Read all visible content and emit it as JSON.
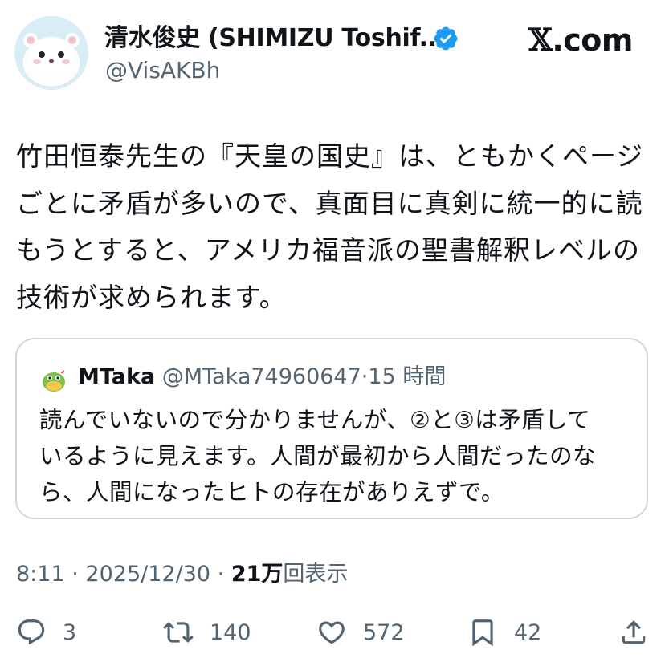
{
  "author": {
    "display_name": "清水俊史 (SHIMIZU Toshif...",
    "handle": "@VisAKBh",
    "verified": true
  },
  "site": {
    "logo_letter": "𝕏",
    "logo_suffix": ".com"
  },
  "tweet": {
    "lines": [
      "竹田恒泰先生の『天皇の国史』は、ともかくページ",
      "ごとに矛盾が多いので、真面目に真剣に統一的に読",
      "もうとすると、アメリカ福音派の聖書解釈レベルの",
      "技術が求められます。"
    ]
  },
  "quote": {
    "name": "MTaka",
    "handle": "@MTaka74960647",
    "separator": "·",
    "time": "15 時間",
    "lines": [
      "読んでいないので分かりませんが、②と③は矛盾して",
      "いるように見えます。人間が最初から人間だったのな",
      "ら、人間になったヒトの存在がありえずで。"
    ]
  },
  "meta": {
    "time": "8:11",
    "sep1": "·",
    "date": "2025/12/30",
    "sep2": "·",
    "views_count": "21万",
    "views_label": "回表示"
  },
  "actions": {
    "reply_count": "3",
    "retweet_count": "140",
    "like_count": "572",
    "bookmark_count": "42"
  },
  "colors": {
    "text": "#0f1419",
    "secondary": "#536471",
    "border": "#cfd9de",
    "verified": "#1d9bf0"
  },
  "icons": [
    "verified-badge-icon",
    "reply-icon",
    "retweet-icon",
    "like-icon",
    "bookmark-icon",
    "share-icon"
  ]
}
